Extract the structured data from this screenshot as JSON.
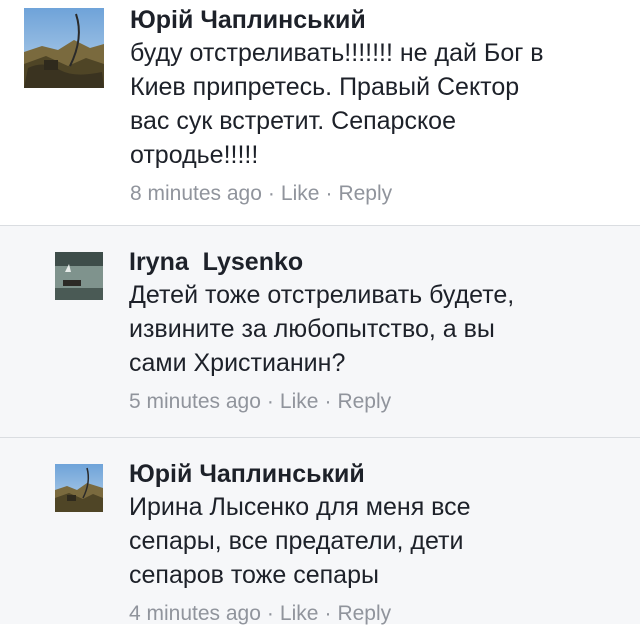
{
  "comments": [
    {
      "author": "Юрій Чаплинський",
      "text_lines": [
        "буду отстреливать!!!!!!! не дай Бог в",
        "Киев припретесь. Правый Сектор",
        "вас сук встретит. Сепарское",
        "отродье!!!!!"
      ],
      "time": "8 minutes ago",
      "like_label": "Like",
      "reply_label": "Reply",
      "separator": "·",
      "avatar_icon": "landscape-photo-icon"
    },
    {
      "author": "Iryna  Lysenko",
      "text_lines": [
        "Детей тоже отстреливать будете,",
        "извините за любопытство, а вы",
        "сами Христианин?"
      ],
      "time": "5 minutes ago",
      "like_label": "Like",
      "reply_label": "Reply",
      "separator": "·",
      "avatar_icon": "lake-photo-icon"
    },
    {
      "author": "Юрій Чаплинський",
      "text_lines": [
        "Ирина Лысенко для меня все",
        "сепары, все предатели, дети",
        "сепаров тоже сепары"
      ],
      "time": "4 minutes ago",
      "like_label": "Like",
      "reply_label": "Reply",
      "separator": "·",
      "avatar_icon": "landscape-photo-icon"
    }
  ],
  "colors": {
    "author": "#1d2129",
    "meta": "#90949c",
    "reply_background": "#f6f7f9",
    "divider": "#dadde1"
  }
}
